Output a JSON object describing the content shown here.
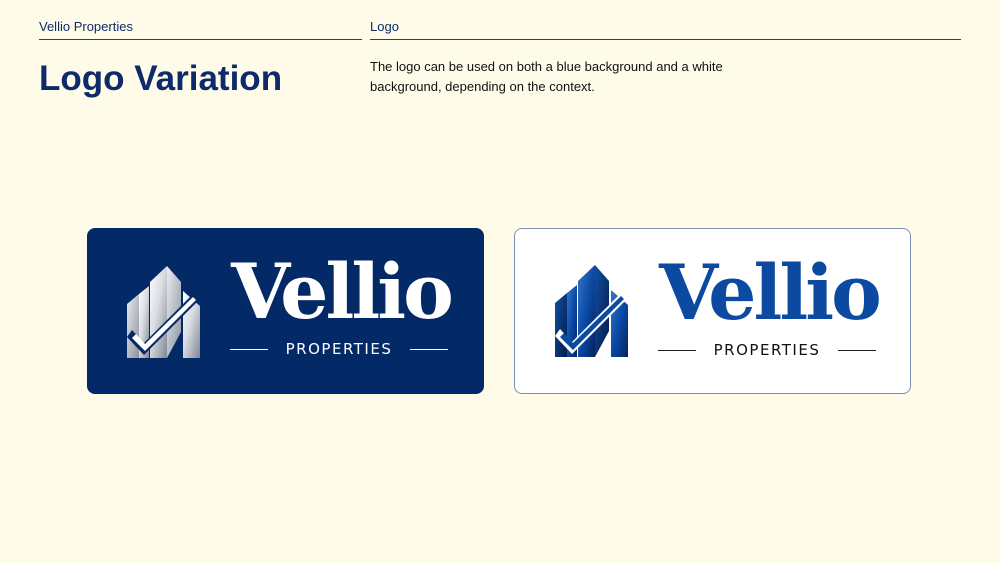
{
  "header": {
    "brand_name": "Vellio Properties",
    "section": "Logo"
  },
  "page": {
    "title": "Logo Variation",
    "description": "The logo can be used on both a blue background and a white background, depending on the context."
  },
  "logos": [
    {
      "variant": "blue background",
      "wordmark": "Vellio",
      "subtitle": "PROPERTIES",
      "background_color": "#032967",
      "mark_icon": "building-checkmark-icon"
    },
    {
      "variant": "white background",
      "wordmark": "Vellio",
      "subtitle": "PROPERTIES",
      "background_color": "#ffffff",
      "mark_icon": "building-checkmark-icon"
    }
  ],
  "colors": {
    "background": "#fefbe8",
    "text_primary": "#0e2a6b",
    "brand_blue": "#032967",
    "logo_blue": "#0b4aa0"
  }
}
